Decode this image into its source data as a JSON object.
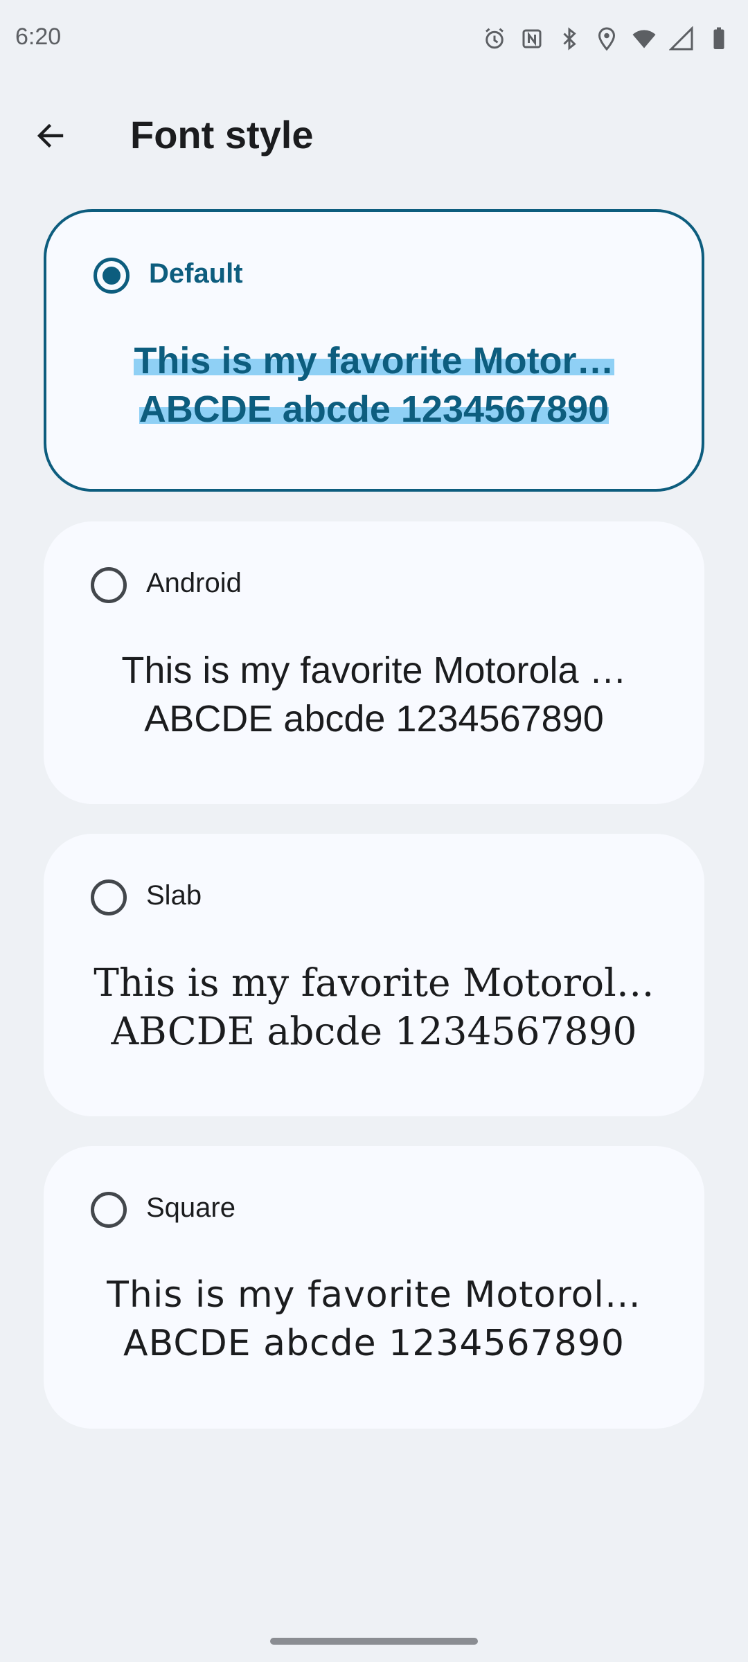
{
  "status_bar": {
    "time": "6:20",
    "icons": [
      "alarm-icon",
      "nfc-icon",
      "bluetooth-icon",
      "location-icon",
      "wifi-icon",
      "signal-icon",
      "battery-icon"
    ]
  },
  "app_bar": {
    "title": "Font style"
  },
  "options": [
    {
      "label": "Default",
      "selected": true,
      "preview_line1": "This is my favorite Motor…",
      "preview_line2": "ABCDE abcde 1234567890"
    },
    {
      "label": "Android",
      "selected": false,
      "preview_line1": "This is my favorite Motorola …",
      "preview_line2": "ABCDE abcde 1234567890"
    },
    {
      "label": "Slab",
      "selected": false,
      "preview_line1": "This is my favorite Motorol…",
      "preview_line2": "ABCDE abcde 1234567890"
    },
    {
      "label": "Square",
      "selected": false,
      "preview_line1": "This is my favorite Motorol…",
      "preview_line2": "ABCDE abcde 1234567890"
    }
  ],
  "colors": {
    "accent": "#0d5d7e",
    "highlight": "#8fd0f5",
    "background": "#eef1f5",
    "card": "#f8faff"
  }
}
